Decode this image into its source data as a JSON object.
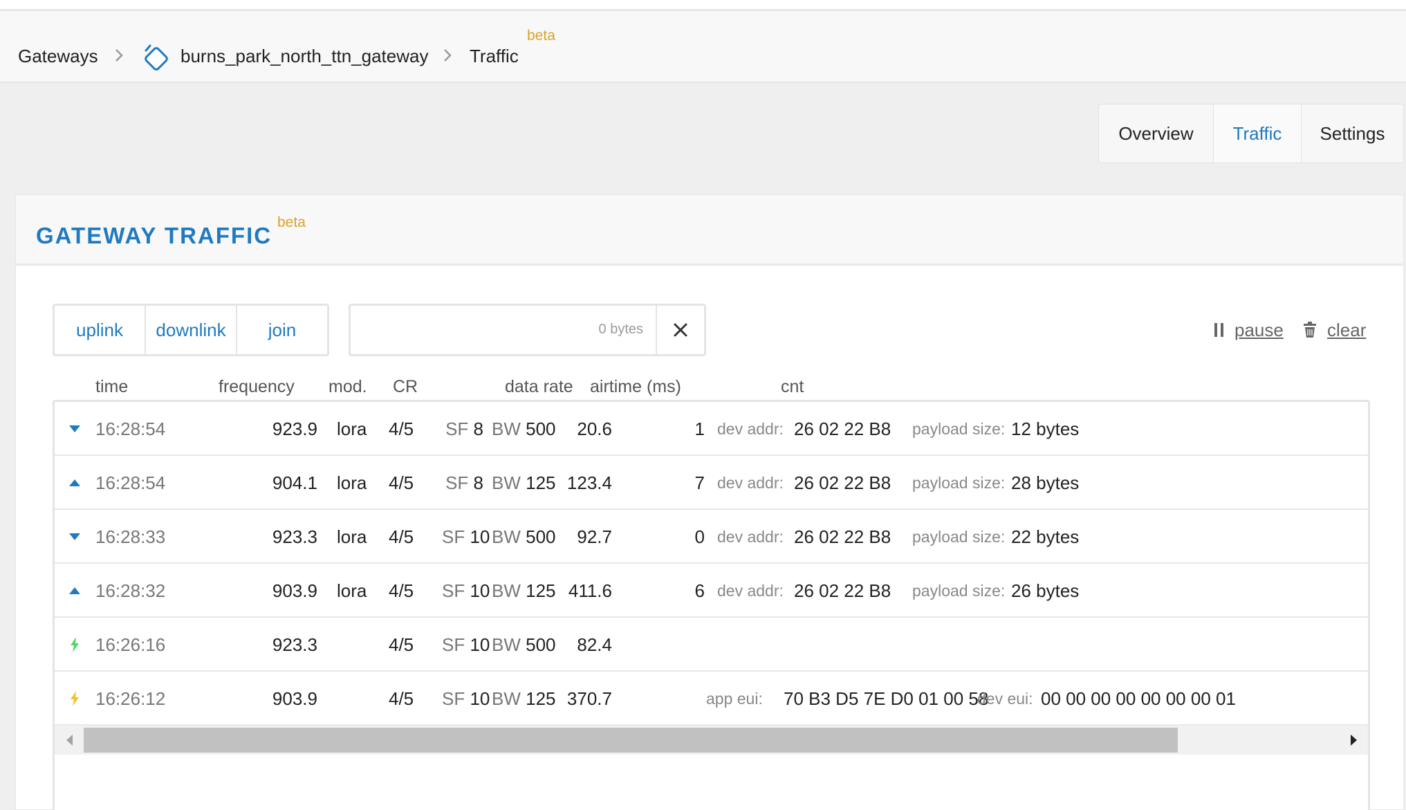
{
  "breadcrumb": {
    "root": "Gateways",
    "gateway": "burns_park_north_ttn_gateway",
    "page": "Traffic",
    "badge": "beta"
  },
  "tabs": [
    "Overview",
    "Traffic",
    "Settings"
  ],
  "active_tab": "Traffic",
  "card": {
    "title": "GATEWAY TRAFFIC",
    "badge": "beta"
  },
  "filters": [
    "uplink",
    "downlink",
    "join"
  ],
  "search": {
    "value": "",
    "bytes": "0 bytes"
  },
  "actions": {
    "pause": "pause",
    "clear": "clear"
  },
  "columns": {
    "time": "time",
    "frequency": "frequency",
    "mod": "mod.",
    "cr": "CR",
    "data_rate": "data rate",
    "airtime": "airtime (ms)",
    "cnt": "cnt"
  },
  "labels": {
    "sf": "SF",
    "bw": "BW",
    "dev_addr": "dev addr:",
    "payload_size": "payload size:",
    "app_eui": "app eui:",
    "dev_eui": "dev eui:"
  },
  "rows": [
    {
      "dir": "downlink",
      "time": "16:28:54",
      "frequency": "923.9",
      "mod": "lora",
      "cr": "4/5",
      "sf": "8",
      "bw": "500",
      "airtime": "20.6",
      "cnt": "1",
      "dev_addr": "26 02 22 B8",
      "payload": "12 bytes"
    },
    {
      "dir": "uplink",
      "time": "16:28:54",
      "frequency": "904.1",
      "mod": "lora",
      "cr": "4/5",
      "sf": "8",
      "bw": "125",
      "airtime": "123.4",
      "cnt": "7",
      "dev_addr": "26 02 22 B8",
      "payload": "28 bytes"
    },
    {
      "dir": "downlink",
      "time": "16:28:33",
      "frequency": "923.3",
      "mod": "lora",
      "cr": "4/5",
      "sf": "10",
      "bw": "500",
      "airtime": "92.7",
      "cnt": "0",
      "dev_addr": "26 02 22 B8",
      "payload": "22 bytes"
    },
    {
      "dir": "uplink",
      "time": "16:28:32",
      "frequency": "903.9",
      "mod": "lora",
      "cr": "4/5",
      "sf": "10",
      "bw": "125",
      "airtime": "411.6",
      "cnt": "6",
      "dev_addr": "26 02 22 B8",
      "payload": "26 bytes"
    },
    {
      "dir": "join-accept",
      "time": "16:26:16",
      "frequency": "923.3",
      "cr": "4/5",
      "sf": "10",
      "bw": "500",
      "airtime": "82.4"
    },
    {
      "dir": "join-request",
      "time": "16:26:12",
      "frequency": "903.9",
      "cr": "4/5",
      "sf": "10",
      "bw": "125",
      "airtime": "370.7",
      "app_eui": "70 B3 D5 7E D0 01 00 58",
      "dev_eui": "00 00 00 00 00 00 00 01"
    }
  ],
  "colors": {
    "accent": "#1f7ac1",
    "beta": "#dca226",
    "join_accept": "#4cd964",
    "join_request": "#f2c12e"
  },
  "icons": {
    "gateway": "gateway-icon",
    "chevron": "chevron-right-icon",
    "close": "close-icon",
    "pause": "pause-icon",
    "clear": "trash-icon",
    "uplink": "triangle-up-icon",
    "downlink": "triangle-down-icon",
    "join": "lightning-icon"
  }
}
